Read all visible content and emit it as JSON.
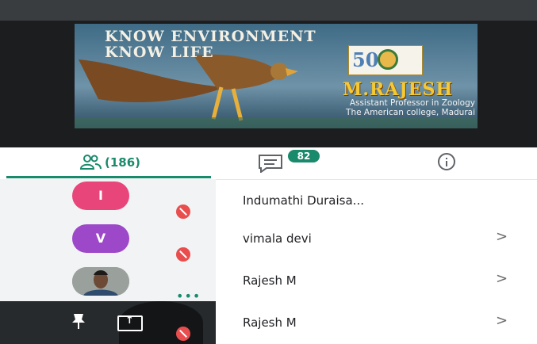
{
  "banner": {
    "title_line1": "KNOW ENVIRONMENT",
    "title_line2": "KNOW LIFE",
    "name": "M.RAJESH",
    "subtitle_line1": "Assistant Professor in Zoology",
    "subtitle_line2": "The American college, Madurai",
    "logo_number": "50"
  },
  "tabs": {
    "people_count": "(186)",
    "chat_badge": "82"
  },
  "participants": [
    {
      "initial": "I",
      "name": "Indumathi Duraisa...",
      "avatar_color": "#e8457a",
      "chevron": ""
    },
    {
      "initial": "V",
      "name": "vimala devi",
      "avatar_color": "#9c48c8",
      "chevron": ">"
    },
    {
      "initial": "",
      "name": "Rajesh M",
      "avatar_color": "",
      "chevron": ">"
    },
    {
      "initial": "",
      "name": "Rajesh M",
      "avatar_color": "",
      "chevron": ">"
    }
  ],
  "indicators": {
    "more_dots": "•••"
  },
  "colors": {
    "accent": "#1a8a6c",
    "muted_mic": "#ea4d4d"
  },
  "icons": [
    "people-icon",
    "chat-icon",
    "info-icon",
    "mic-off-icon",
    "pin-icon",
    "present-screen-icon",
    "chevron-right-icon"
  ]
}
